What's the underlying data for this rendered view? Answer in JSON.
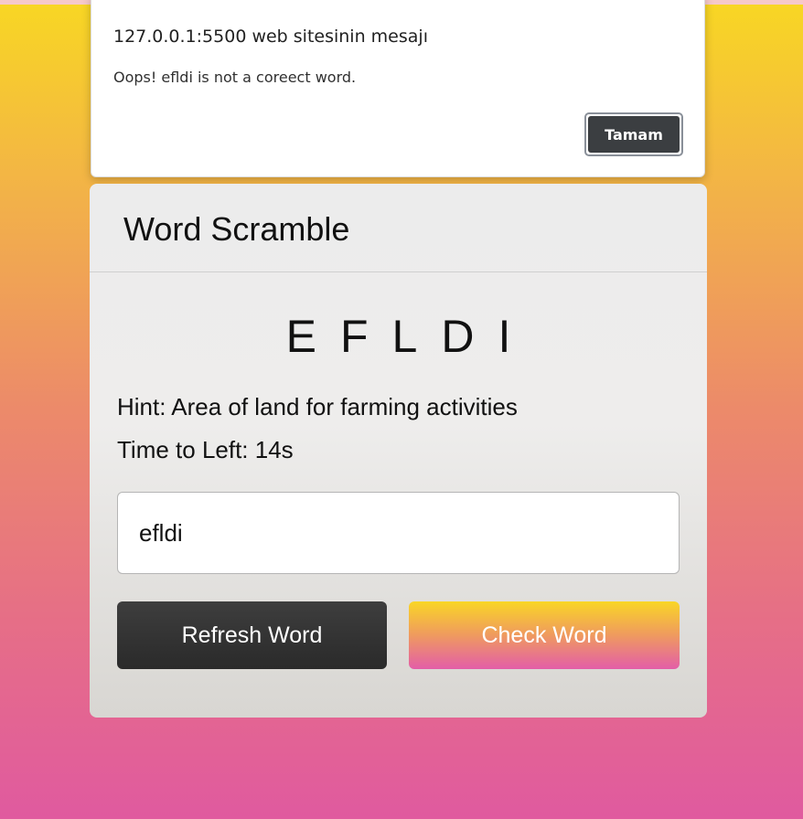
{
  "alert": {
    "title": "127.0.0.1:5500 web sitesinin mesajı",
    "message": "Oops! efldi is not a coreect word.",
    "ok_label": "Tamam"
  },
  "game": {
    "title": "Word Scramble",
    "scrambled_word": "EFLDI",
    "hint_text": "Hint: Area of land for farming activities",
    "time_text": "Time to Left: 14s",
    "input_value": "efldi",
    "refresh_label": "Refresh Word",
    "check_label": "Check Word"
  },
  "colors": {
    "background_top": "#f8d723",
    "background_bottom": "#e05a9f",
    "refresh_button": "#333333",
    "check_button_top": "#f9d626",
    "check_button_bottom": "#e35ea8"
  }
}
